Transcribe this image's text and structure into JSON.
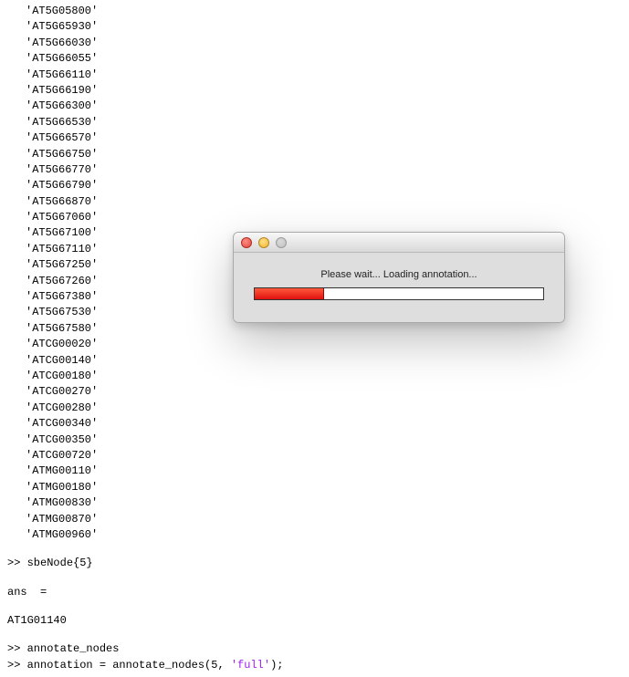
{
  "gene_quote": "'",
  "genes": [
    "AT5G05800",
    "AT5G65930",
    "AT5G66030",
    "AT5G66055",
    "AT5G66110",
    "AT5G66190",
    "AT5G66300",
    "AT5G66530",
    "AT5G66570",
    "AT5G66750",
    "AT5G66770",
    "AT5G66790",
    "AT5G66870",
    "AT5G67060",
    "AT5G67100",
    "AT5G67110",
    "AT5G67250",
    "AT5G67260",
    "AT5G67380",
    "AT5G67530",
    "AT5G67580",
    "ATCG00020",
    "ATCG00140",
    "ATCG00180",
    "ATCG00270",
    "ATCG00280",
    "ATCG00340",
    "ATCG00350",
    "ATCG00720",
    "ATMG00110",
    "ATMG00180",
    "ATMG00830",
    "ATMG00870",
    "ATMG00960"
  ],
  "commands": {
    "prompt": ">> ",
    "line1": "sbeNode{5}",
    "ans_label": "ans  =",
    "ans_value": "AT1G01140",
    "line2": "annotate_nodes",
    "line3_prefix": "annotation = annotate_nodes(5, ",
    "line3_str": "'full'",
    "line3_suffix": ");"
  },
  "dialog": {
    "message": "Please wait... Loading annotation...",
    "progress_percent": 24
  }
}
